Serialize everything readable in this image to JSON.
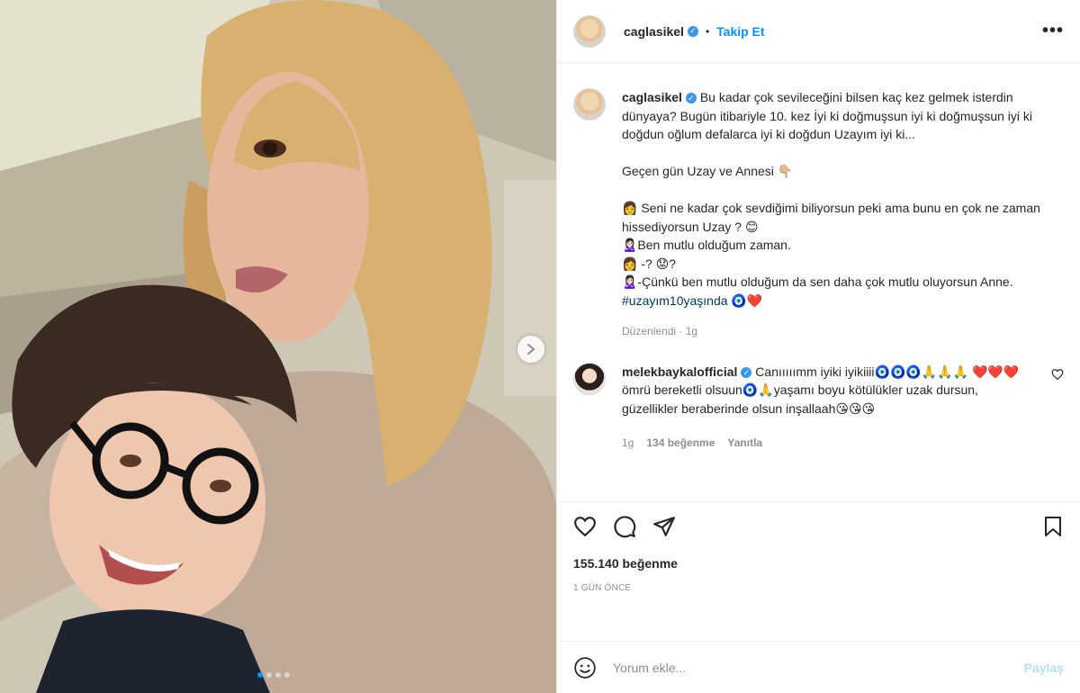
{
  "post": {
    "author": "caglasikel",
    "follow_label": "Takip Et",
    "separator": "•",
    "more_label": "•••",
    "carousel": {
      "dots": 4,
      "active_index": 0
    }
  },
  "caption": {
    "author": "caglasikel",
    "lines": [
      "Bu kadar çok sevileceğini bilsen kaç kez gelmek isterdin dünyaya? Bugün itibariyle 10. kez İyi ki doğmuşsun iyi ki doğmuşsun iyi ki doğdun oğlum defalarca iyi ki doğdun Uzayım iyi ki...",
      "",
      "Geçen gün Uzay ve Annesi 👇🏼",
      "",
      "👩 Seni ne kadar çok sevdiğimi biliyorsun peki ama bunu en çok ne zaman hissediyorsun Uzay ? 😊",
      "🙎🏻‍♀️Ben mutlu olduğum zaman.",
      "👩 -? 😟?",
      "🙎🏻‍♀️-Çünkü ben mutlu olduğum da sen daha çok mutlu oluyorsun Anne."
    ],
    "hashtag": "#uzayım10yaşında",
    "hashtag_suffix": " 🧿❤️",
    "edited": "Düzenlendi",
    "edited_sep": "·",
    "edited_time": "1g"
  },
  "comment": {
    "author": "melekbaykalofficial",
    "text": "Canııııımm iyiki iyikiiii🧿🧿🧿🙏🙏🙏 ❤️❤️❤️ömrü bereketli olsuun🧿🙏yaşamı boyu kötülükler uzak dursun, güzellikler beraberinde olsun inşallaah😘😘😘",
    "time": "1g",
    "likes": "134 beğenme",
    "reply": "Yanıtla"
  },
  "stats": {
    "likes": "155.140 beğenme",
    "date": "1 GÜN ÖNCE"
  },
  "composer": {
    "placeholder": "Yorum ekle...",
    "post_label": "Paylaş"
  },
  "colors": {
    "accent": "#0095f6",
    "muted": "#8e8e8e",
    "text": "#262626",
    "hashtag": "#00376b"
  }
}
